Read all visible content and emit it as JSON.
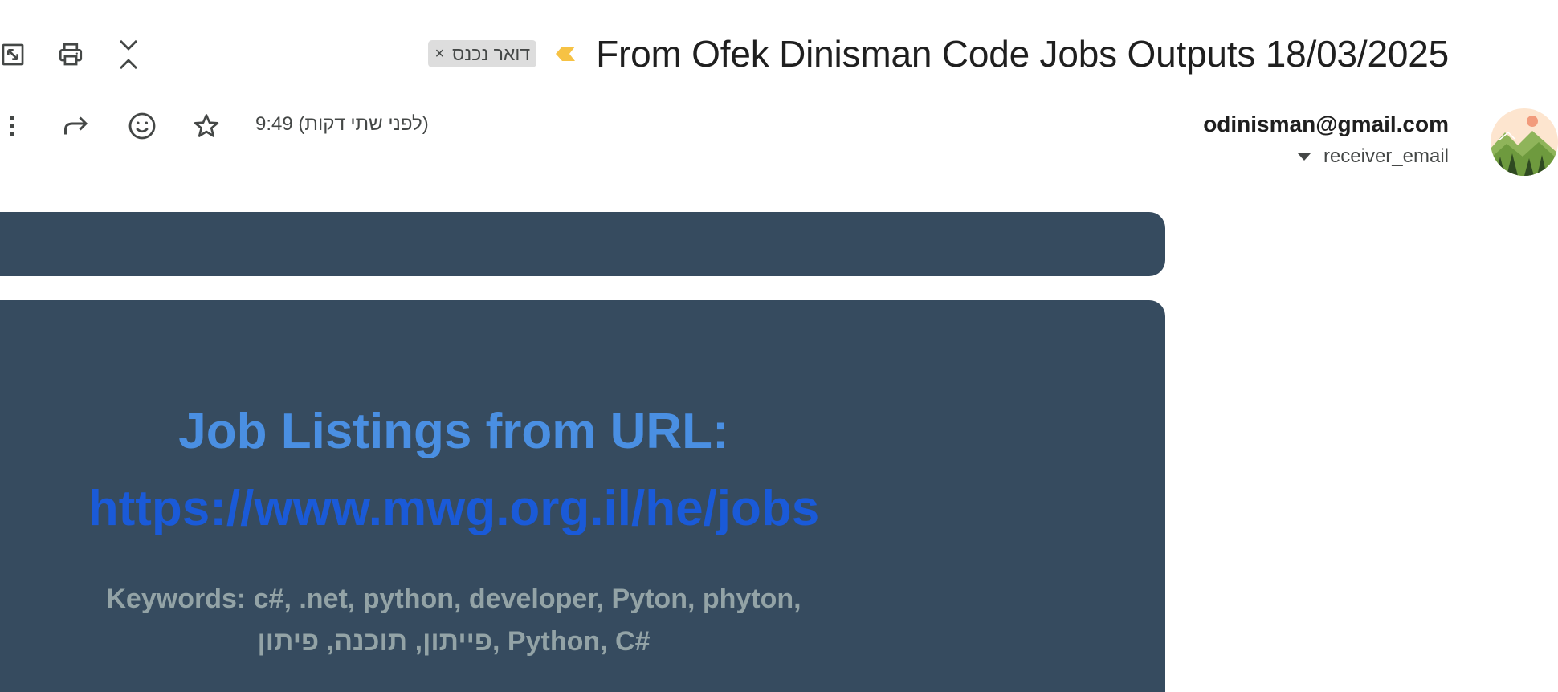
{
  "toolbar": {
    "popout_icon": "open-in-new-window-icon",
    "print_icon": "print-icon",
    "collapse_icon": "collapse-all-icon"
  },
  "subject": {
    "text": "From Ofek Dinisman Code Jobs Outputs 18/03/2025",
    "label_chip": "דואר נכנס",
    "label_chip_remove": "×",
    "important_color": "#f6c244"
  },
  "message": {
    "sender_email": "odinisman@gmail.com",
    "receiver": "receiver_email",
    "timestamp": "9:49 (לפני שתי דקות)",
    "actions": [
      "more-options-icon",
      "forward-icon",
      "emoji-reaction-icon",
      "star-icon"
    ]
  },
  "body": {
    "card_color": "#364b5f",
    "title": "Job Listings from URL:",
    "title_color": "#4a8fe2",
    "url": "https://www.mwg.org.il/he/jobs",
    "url_color": "#1a5ad8",
    "keywords_line1": "Keywords: c#, .net, python, developer, Pyton, phyton,",
    "keywords_line2": "פייתון, תוכנה, פיתון, Python, C#",
    "keywords_color": "#93a3a6"
  }
}
